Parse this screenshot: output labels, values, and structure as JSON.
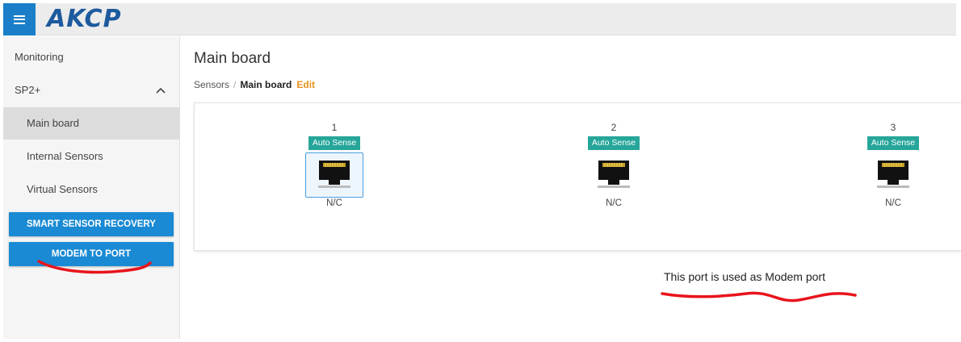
{
  "header": {
    "menu_icon": "hamburger-menu-icon",
    "logo_text": "AKCP",
    "brand_color": "#1a7fc8"
  },
  "sidebar": {
    "items": [
      {
        "label": "Monitoring"
      },
      {
        "label": "SP2+",
        "icon": "chevron-up-icon"
      },
      {
        "label": "Main board",
        "active": true
      },
      {
        "label": "Internal Sensors"
      },
      {
        "label": "Virtual Sensors"
      }
    ],
    "buttons": [
      {
        "label": "SMART SENSOR RECOVERY"
      },
      {
        "label": "MODEM TO PORT"
      }
    ],
    "button_color": "#1a8ad4"
  },
  "main": {
    "title": "Main board",
    "breadcrumb": {
      "root": "Sensors",
      "separator": "/",
      "current": "Main board",
      "edit": "Edit"
    },
    "ports": [
      {
        "number": "1",
        "badge": "Auto Sense",
        "status": "N/C",
        "selected": true,
        "icon": "rj45-port-icon"
      },
      {
        "number": "2",
        "badge": "Auto Sense",
        "status": "N/C",
        "selected": false,
        "icon": "rj45-port-icon"
      },
      {
        "number": "3",
        "badge": "Auto Sense",
        "status": "N/C",
        "selected": false,
        "icon": "rj45-port-icon"
      }
    ],
    "badge_color": "#26a69a",
    "note": "This port is used as Modem port"
  },
  "annotations": {
    "underline_color": "#e8141c"
  }
}
